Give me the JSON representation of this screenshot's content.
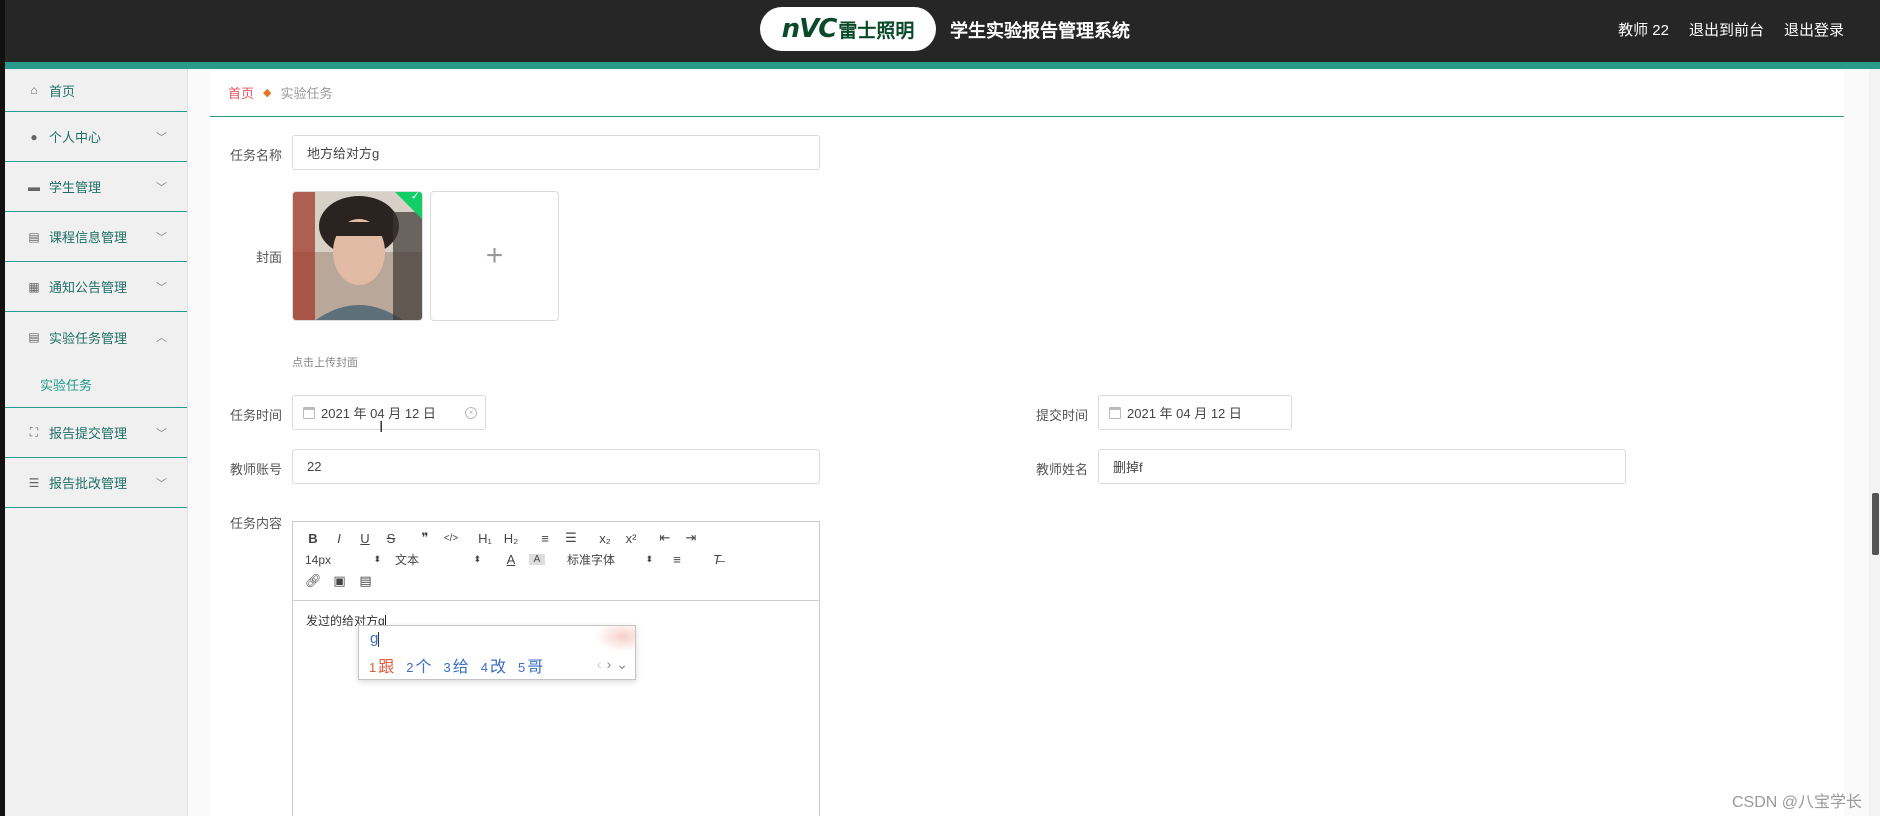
{
  "header": {
    "logo_mark": "nVC",
    "logo_text": "雷士照明",
    "title": "学生实验报告管理系统",
    "user": "教师 22",
    "link_front": "退出到前台",
    "link_logout": "退出登录"
  },
  "sidebar": {
    "items": [
      {
        "label": "首页",
        "icon": "home-icon"
      },
      {
        "label": "个人中心",
        "icon": "user-icon"
      },
      {
        "label": "学生管理",
        "icon": "monitor-icon"
      },
      {
        "label": "课程信息管理",
        "icon": "clipboard-icon"
      },
      {
        "label": "通知公告管理",
        "icon": "grid-icon"
      },
      {
        "label": "实验任务管理",
        "icon": "clipboard-icon",
        "expanded": true
      },
      {
        "label": "报告提交管理",
        "icon": "fullscreen-icon"
      },
      {
        "label": "报告批改管理",
        "icon": "list-icon"
      }
    ],
    "sub_item": "实验任务"
  },
  "breadcrumb": {
    "home": "首页",
    "current": "实验任务"
  },
  "form": {
    "task_name_label": "任务名称",
    "task_name_value": "地方给对方g",
    "cover_label": "封面",
    "cover_upload_plus": "+",
    "cover_hint": "点击上传封面",
    "task_time_label": "任务时间",
    "task_time_value": "2021 年 04 月 12 日",
    "submit_time_label": "提交时间",
    "submit_time_value": "2021 年 04 月 12 日",
    "teacher_account_label": "教师账号",
    "teacher_account_value": "22",
    "teacher_name_label": "教师姓名",
    "teacher_name_value": "删掉f",
    "content_label": "任务内容"
  },
  "editor": {
    "toolbar_row1": [
      "B",
      "I",
      "U",
      "S",
      "❞",
      "</>",
      "H₁",
      "H₂",
      "≡",
      "☰",
      "x₂",
      "x²",
      "⇤",
      "⇥"
    ],
    "font_size": "14px",
    "block_format": "文本",
    "font_family": "标准字体",
    "content": "发过的给对方g"
  },
  "ime": {
    "input": "g",
    "candidates": [
      {
        "n": "1",
        "text": "跟"
      },
      {
        "n": "2",
        "text": "个"
      },
      {
        "n": "3",
        "text": "给"
      },
      {
        "n": "4",
        "text": "改"
      },
      {
        "n": "5",
        "text": "哥"
      }
    ]
  },
  "watermark": "CSDN @八宝学长",
  "colors": {
    "accent": "#2a9a8a",
    "topbar": "#262626",
    "breadcrumb_home": "#e05565",
    "ime_first": "#e05a3a",
    "ime_other": "#3a6fc2"
  }
}
